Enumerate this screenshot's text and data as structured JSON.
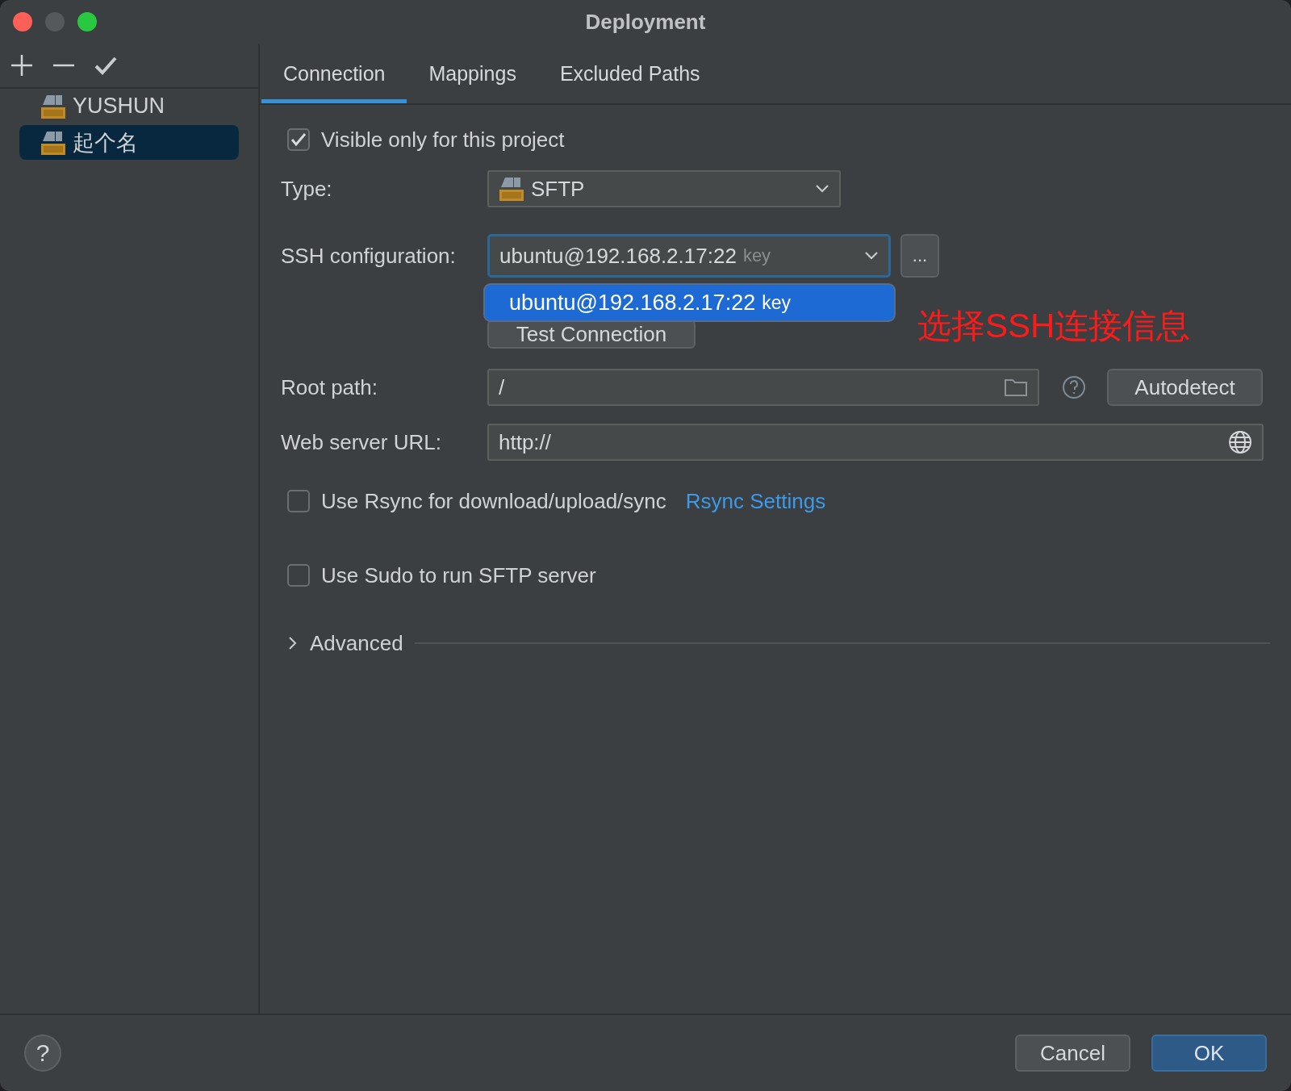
{
  "window": {
    "title": "Deployment"
  },
  "servers": [
    {
      "name": "YUSHUN",
      "selected": false
    },
    {
      "name": "起个名",
      "selected": true
    }
  ],
  "tabs": [
    {
      "label": "Connection",
      "selected": true
    },
    {
      "label": "Mappings",
      "selected": false
    },
    {
      "label": "Excluded Paths",
      "selected": false
    }
  ],
  "form": {
    "visible_only": {
      "label": "Visible only for this project",
      "checked": true
    },
    "type": {
      "label": "Type:",
      "value": "SFTP"
    },
    "ssh": {
      "label": "SSH configuration:",
      "value": "ubuntu@192.168.2.17:22",
      "hint": "key",
      "more": "..."
    },
    "ssh_options": [
      {
        "value": "ubuntu@192.168.2.17:22",
        "hint": "key",
        "selected": true
      }
    ],
    "test_button": "Test Connection",
    "root_path": {
      "label": "Root path:",
      "value": "/",
      "button": "Autodetect"
    },
    "web_url": {
      "label": "Web server URL:",
      "value": "http://"
    },
    "rsync": {
      "label": "Use Rsync for download/upload/sync",
      "checked": false,
      "link": "Rsync Settings"
    },
    "sudo": {
      "label": "Use Sudo to run SFTP server",
      "checked": false
    },
    "advanced": {
      "label": "Advanced",
      "expanded": false
    }
  },
  "annotation": "选择SSH连接信息",
  "footer": {
    "help": "?",
    "buttons": [
      {
        "label": "Cancel",
        "kind": "default"
      },
      {
        "label": "OK",
        "kind": "primary"
      }
    ]
  }
}
